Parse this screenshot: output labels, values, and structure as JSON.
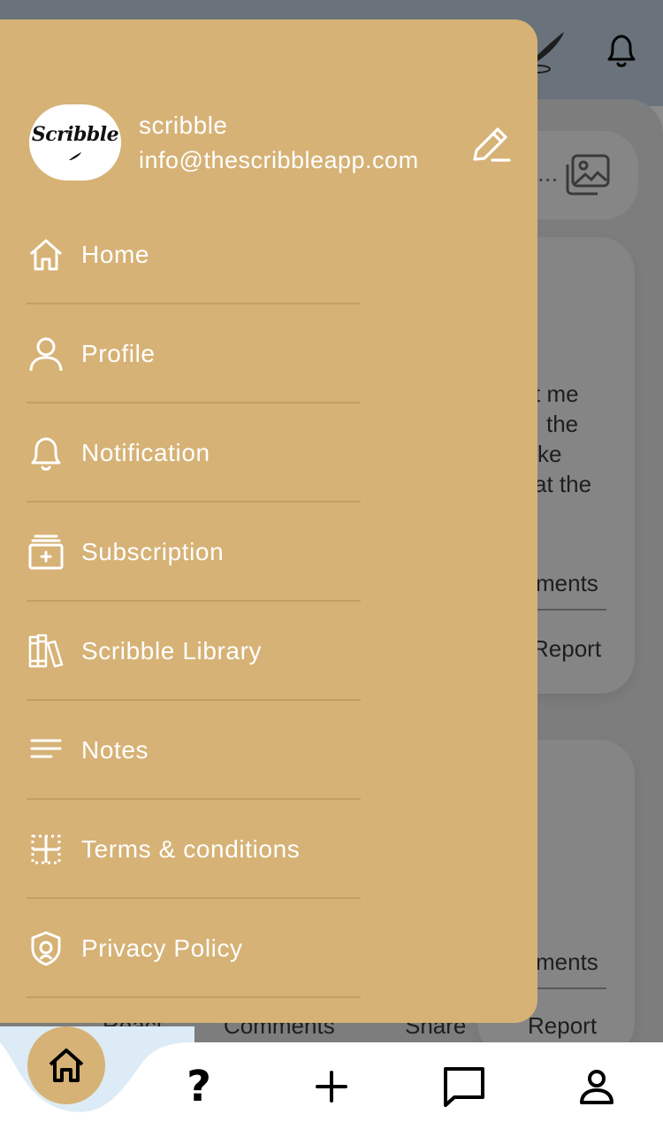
{
  "colors": {
    "drawer": "#d6b276",
    "divider": "#c59f62",
    "overlay": "#7d7d7d",
    "nav_background": "#ffffff",
    "bubble": "#dcebf5"
  },
  "background": {
    "text_lines": [
      "t me",
      "the",
      "ke",
      "at the"
    ],
    "comments_1": "ments",
    "report_1": "Report",
    "comments_2": "ments",
    "actions": {
      "react": "React",
      "comments": "Comments",
      "share": "Share",
      "report": "Report"
    },
    "search_hint": "..."
  },
  "drawer": {
    "avatar_text": "Scribble",
    "user_name": "scribble",
    "user_email": "info@thescribbleapp.com",
    "items": [
      {
        "label": "Home",
        "icon": "home-icon"
      },
      {
        "label": "Profile",
        "icon": "user-icon"
      },
      {
        "label": "Notification",
        "icon": "bell-icon"
      },
      {
        "label": "Subscription",
        "icon": "subscription-icon"
      },
      {
        "label": "Scribble Library",
        "icon": "library-icon"
      },
      {
        "label": "Notes",
        "icon": "notes-icon"
      },
      {
        "label": "Terms & conditions",
        "icon": "terms-icon"
      },
      {
        "label": "Privacy Policy",
        "icon": "shield-icon"
      }
    ]
  },
  "bottom_nav": {
    "active": "home",
    "help_label": "?",
    "items": [
      "home-icon",
      "help-icon",
      "plus-icon",
      "chat-icon",
      "user-icon"
    ]
  }
}
